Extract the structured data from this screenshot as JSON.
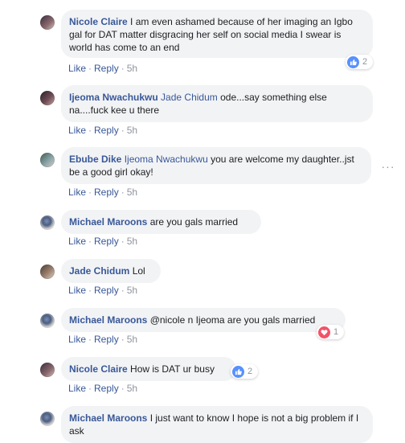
{
  "actions": {
    "like": "Like",
    "reply": "Reply",
    "sep": "·"
  },
  "comments": [
    {
      "author": "Nicole Claire",
      "text": "I am even ashamed because of her imaging an Igbo gal for DAT matter disgracing her self on social media I swear is world has come to an end",
      "time": "5h",
      "reactions": {
        "count": "2",
        "type": "like-icon"
      }
    },
    {
      "author": "Ijeoma Nwachukwu",
      "mention": "Jade Chidum",
      "text": "ode...say something else na....fuck kee u there",
      "time": "5h"
    },
    {
      "author": "Ebube Dike",
      "mention": "Ijeoma Nwachukwu",
      "text": "you are welcome my daughter..jst be a good girl okay!",
      "time": "5h",
      "more": "···"
    },
    {
      "author": "Michael Maroons",
      "text": "are you gals married",
      "time": "5h"
    },
    {
      "author": "Jade Chidum",
      "text": "Lol",
      "time": "5h"
    },
    {
      "author": "Michael Maroons",
      "text": "@nicole n Ijeoma are you gals married",
      "time": "5h",
      "reactions": {
        "count": "1",
        "type": "love-icon"
      }
    },
    {
      "author": "Nicole Claire",
      "text": "How is DAT ur busy",
      "time": "5h",
      "reactions": {
        "count": "2",
        "type": "like-icon"
      }
    },
    {
      "author": "Michael Maroons",
      "text": "I just want to know I hope is not a big problem if I ask",
      "time": ""
    }
  ],
  "colors": {
    "link": "#385898",
    "bubble": "#f2f3f5",
    "meta": "#90949c",
    "like": "#5890ff",
    "love": "#f25268"
  }
}
